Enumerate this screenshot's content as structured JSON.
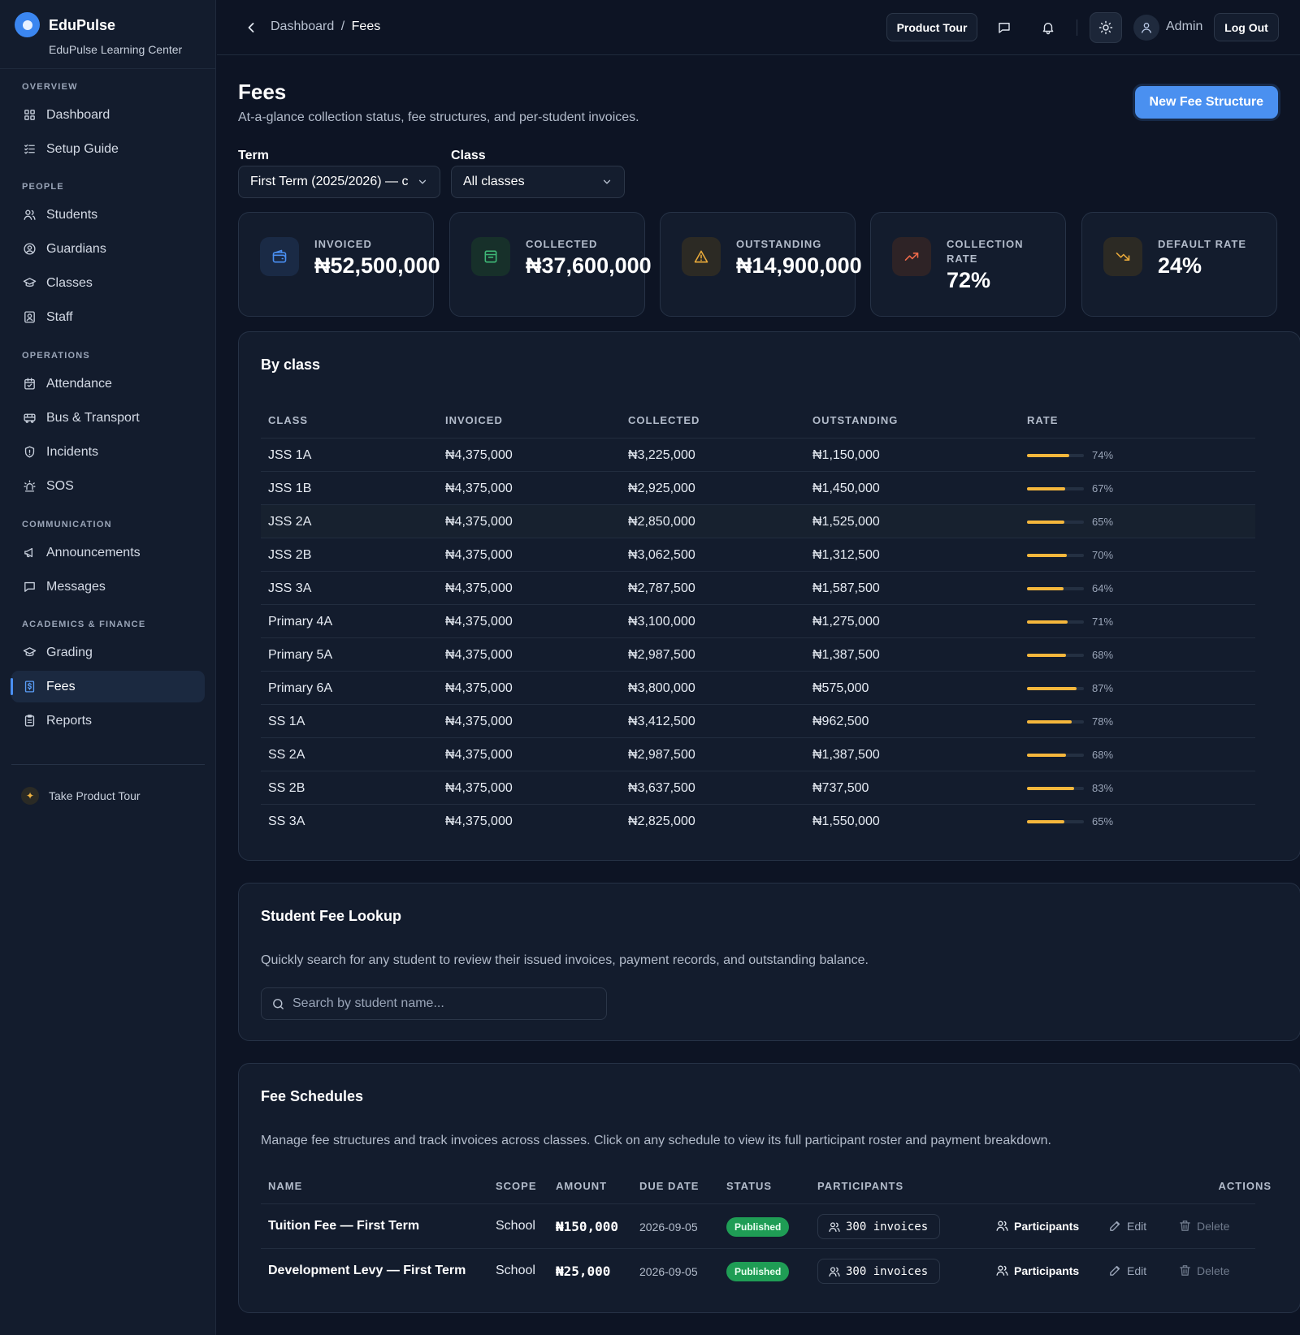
{
  "brand": {
    "name": "EduPulse",
    "subtitle": "EduPulse Learning Center"
  },
  "sidebar": {
    "sections": [
      {
        "title": "OVERVIEW",
        "items": [
          {
            "label": "Dashboard",
            "icon": "dashboard-icon"
          },
          {
            "label": "Setup Guide",
            "icon": "checklist-icon"
          }
        ]
      },
      {
        "title": "PEOPLE",
        "items": [
          {
            "label": "Students",
            "icon": "users-icon"
          },
          {
            "label": "Guardians",
            "icon": "user-circle-icon"
          },
          {
            "label": "Classes",
            "icon": "graduation-cap-icon"
          },
          {
            "label": "Staff",
            "icon": "id-badge-icon"
          }
        ]
      },
      {
        "title": "OPERATIONS",
        "items": [
          {
            "label": "Attendance",
            "icon": "calendar-check-icon"
          },
          {
            "label": "Bus & Transport",
            "icon": "bus-icon"
          },
          {
            "label": "Incidents",
            "icon": "shield-icon"
          },
          {
            "label": "SOS",
            "icon": "siren-icon"
          }
        ]
      },
      {
        "title": "COMMUNICATION",
        "items": [
          {
            "label": "Announcements",
            "icon": "megaphone-icon"
          },
          {
            "label": "Messages",
            "icon": "message-icon"
          }
        ]
      },
      {
        "title": "ACADEMICS & FINANCE",
        "items": [
          {
            "label": "Grading",
            "icon": "graduation-cap-icon"
          },
          {
            "label": "Fees",
            "icon": "receipt-icon",
            "active": true
          },
          {
            "label": "Reports",
            "icon": "clipboard-icon"
          }
        ]
      }
    ],
    "tour_link": "Take Product Tour"
  },
  "topbar": {
    "breadcrumb_parent": "Dashboard",
    "breadcrumb_sep": "/",
    "breadcrumb_current": "Fees",
    "product_tour": "Product Tour",
    "user_name": "Admin",
    "logout": "Log Out"
  },
  "page": {
    "title": "Fees",
    "subtitle": "At-a-glance collection status, fee structures, and per-student invoices.",
    "new_button": "New Fee Structure"
  },
  "filters": {
    "term_label": "Term",
    "term_value": "First Term (2025/2026) — c",
    "class_label": "Class",
    "class_value": "All classes"
  },
  "stats": [
    {
      "label": "INVOICED",
      "value": "₦52,500,000",
      "icon": "wallet-icon",
      "color": "#4a8ff2",
      "bg": "#1a2a45"
    },
    {
      "label": "COLLECTED",
      "value": "₦37,600,000",
      "icon": "inbox-icon",
      "color": "#3fb877",
      "bg": "#17302a"
    },
    {
      "label": "OUTSTANDING",
      "value": "₦14,900,000",
      "icon": "warning-icon",
      "color": "#e8a93a",
      "bg": "#2c2a24"
    },
    {
      "label": "COLLECTION RATE",
      "value": "72%",
      "icon": "trending-up-icon",
      "color": "#ef6a4a",
      "bg": "#2e2326"
    },
    {
      "label": "DEFAULT RATE",
      "value": "24%",
      "icon": "trending-down-icon",
      "color": "#e8a93a",
      "bg": "#2c2a24"
    }
  ],
  "by_class": {
    "title": "By class",
    "headers": [
      "CLASS",
      "INVOICED",
      "COLLECTED",
      "OUTSTANDING",
      "RATE"
    ],
    "rows": [
      {
        "class": "JSS 1A",
        "invoiced": "₦4,375,000",
        "collected": "₦3,225,000",
        "outstanding": "₦1,150,000",
        "rate": 74,
        "rate_label": "74%"
      },
      {
        "class": "JSS 1B",
        "invoiced": "₦4,375,000",
        "collected": "₦2,925,000",
        "outstanding": "₦1,450,000",
        "rate": 67,
        "rate_label": "67%"
      },
      {
        "class": "JSS 2A",
        "invoiced": "₦4,375,000",
        "collected": "₦2,850,000",
        "outstanding": "₦1,525,000",
        "rate": 65,
        "rate_label": "65%"
      },
      {
        "class": "JSS 2B",
        "invoiced": "₦4,375,000",
        "collected": "₦3,062,500",
        "outstanding": "₦1,312,500",
        "rate": 70,
        "rate_label": "70%"
      },
      {
        "class": "JSS 3A",
        "invoiced": "₦4,375,000",
        "collected": "₦2,787,500",
        "outstanding": "₦1,587,500",
        "rate": 64,
        "rate_label": "64%"
      },
      {
        "class": "Primary 4A",
        "invoiced": "₦4,375,000",
        "collected": "₦3,100,000",
        "outstanding": "₦1,275,000",
        "rate": 71,
        "rate_label": "71%"
      },
      {
        "class": "Primary 5A",
        "invoiced": "₦4,375,000",
        "collected": "₦2,987,500",
        "outstanding": "₦1,387,500",
        "rate": 68,
        "rate_label": "68%"
      },
      {
        "class": "Primary 6A",
        "invoiced": "₦4,375,000",
        "collected": "₦3,800,000",
        "outstanding": "₦575,000",
        "rate": 87,
        "rate_label": "87%"
      },
      {
        "class": "SS 1A",
        "invoiced": "₦4,375,000",
        "collected": "₦3,412,500",
        "outstanding": "₦962,500",
        "rate": 78,
        "rate_label": "78%"
      },
      {
        "class": "SS 2A",
        "invoiced": "₦4,375,000",
        "collected": "₦2,987,500",
        "outstanding": "₦1,387,500",
        "rate": 68,
        "rate_label": "68%"
      },
      {
        "class": "SS 2B",
        "invoiced": "₦4,375,000",
        "collected": "₦3,637,500",
        "outstanding": "₦737,500",
        "rate": 83,
        "rate_label": "83%"
      },
      {
        "class": "SS 3A",
        "invoiced": "₦4,375,000",
        "collected": "₦2,825,000",
        "outstanding": "₦1,550,000",
        "rate": 65,
        "rate_label": "65%"
      }
    ]
  },
  "lookup": {
    "title": "Student Fee Lookup",
    "description": "Quickly search for any student to review their issued invoices, payment records, and outstanding balance.",
    "placeholder": "Search by student name..."
  },
  "schedules": {
    "title": "Fee Schedules",
    "description": "Manage fee structures and track invoices across classes. Click on any schedule to view its full participant roster and payment breakdown.",
    "headers": [
      "NAME",
      "SCOPE",
      "AMOUNT",
      "DUE DATE",
      "STATUS",
      "PARTICIPANTS",
      "ACTIONS"
    ],
    "rows": [
      {
        "name": "Tuition Fee — First Term",
        "scope": "School",
        "amount": "₦150,000",
        "due": "2026-09-05",
        "status": "Published",
        "invoices": "300 invoices",
        "participants": "Participants",
        "edit": "Edit",
        "delete": "Delete"
      },
      {
        "name": "Development Levy — First Term",
        "scope": "School",
        "amount": "₦25,000",
        "due": "2026-09-05",
        "status": "Published",
        "invoices": "300 invoices",
        "participants": "Participants",
        "edit": "Edit",
        "delete": "Delete"
      }
    ]
  }
}
